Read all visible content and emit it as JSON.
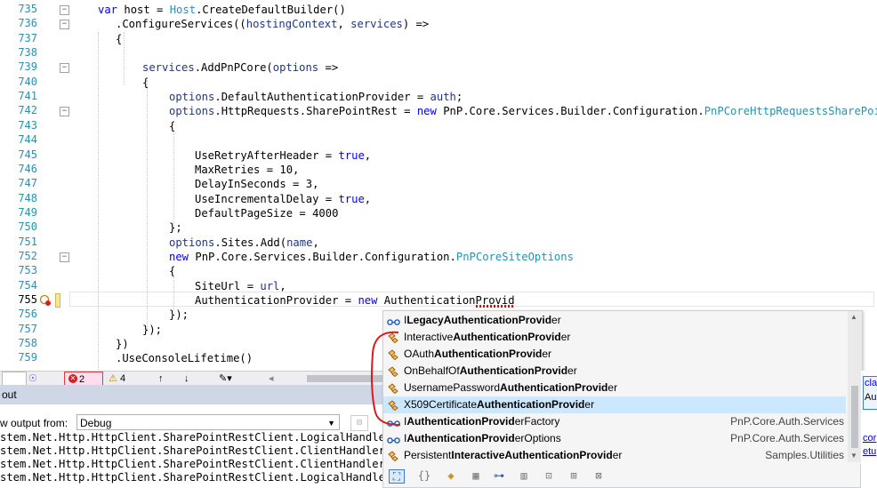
{
  "editor": {
    "lines": [
      {
        "num": "735",
        "text": "var host = Host.CreateDefaultBuilder()"
      },
      {
        "num": "736",
        "text": ".ConfigureServices((hostingContext, services) =>"
      },
      {
        "num": "737",
        "text": "{"
      },
      {
        "num": "738",
        "text": ""
      },
      {
        "num": "739",
        "text": "services.AddPnPCore(options =>"
      },
      {
        "num": "740",
        "text": "{"
      },
      {
        "num": "741",
        "text": "options.DefaultAuthenticationProvider = auth;"
      },
      {
        "num": "742",
        "text": "options.HttpRequests.SharePointRest = new PnP.Core.Services.Builder.Configuration.PnPCoreHttpRequestsSharePoi"
      },
      {
        "num": "743",
        "text": "{"
      },
      {
        "num": "744",
        "text": ""
      },
      {
        "num": "745",
        "text": "UseRetryAfterHeader = true,"
      },
      {
        "num": "746",
        "text": "MaxRetries = 10,"
      },
      {
        "num": "747",
        "text": "DelayInSeconds = 3,"
      },
      {
        "num": "748",
        "text": "UseIncrementalDelay = true,"
      },
      {
        "num": "749",
        "text": "DefaultPageSize = 4000"
      },
      {
        "num": "750",
        "text": "};"
      },
      {
        "num": "751",
        "text": "options.Sites.Add(name,"
      },
      {
        "num": "752",
        "text": "new PnP.Core.Services.Builder.Configuration.PnPCoreSiteOptions"
      },
      {
        "num": "753",
        "text": "{"
      },
      {
        "num": "754",
        "text": "SiteUrl = url,"
      },
      {
        "num": "755",
        "text": "AuthenticationProvider = new AuthenticationProvid"
      },
      {
        "num": "756",
        "text": "});"
      },
      {
        "num": "757",
        "text": "});"
      },
      {
        "num": "758",
        "text": "})"
      },
      {
        "num": "759",
        "text": ".UseConsoleLifetime()"
      }
    ]
  },
  "statusbar": {
    "errors": "2",
    "warnings": "4"
  },
  "output": {
    "title": "out",
    "show_from_label": "w output from:",
    "source": "Debug",
    "lines": [
      "stem.Net.Http.HttpClient.SharePointRestClient.LogicalHandler: I",
      "stem.Net.Http.HttpClient.SharePointRestClient.ClientHandler: I",
      "stem.Net.Http.HttpClient.SharePointRestClient.ClientHandler: I",
      "stem.Net.Http.HttpClient.SharePointRestClient.LogicalHandler: I"
    ]
  },
  "completion": {
    "items": [
      {
        "pre": "I",
        "match": "LegacyAuthenticationProvid",
        "post": "er",
        "ns": "",
        "icon": "interface-icon",
        "selected": false
      },
      {
        "pre": "Interactive",
        "match": "AuthenticationProvid",
        "post": "er",
        "ns": "",
        "icon": "class-icon",
        "selected": false
      },
      {
        "pre": "OAuth",
        "match": "AuthenticationProvid",
        "post": "er",
        "ns": "",
        "icon": "class-icon",
        "selected": false
      },
      {
        "pre": "OnBehalfOf",
        "match": "AuthenticationProvid",
        "post": "er",
        "ns": "",
        "icon": "class-icon",
        "selected": false
      },
      {
        "pre": "UsernamePassword",
        "match": "AuthenticationProvid",
        "post": "er",
        "ns": "",
        "icon": "class-icon",
        "selected": false
      },
      {
        "pre": "X509Certificate",
        "match": "AuthenticationProvid",
        "post": "er",
        "ns": "",
        "icon": "class-icon",
        "selected": true
      },
      {
        "pre": "I",
        "match": "AuthenticationProvid",
        "post": "erFactory",
        "ns": "PnP.Core.Auth.Services",
        "icon": "interface-icon",
        "selected": false
      },
      {
        "pre": "I",
        "match": "AuthenticationProvid",
        "post": "erOptions",
        "ns": "PnP.Core.Auth.Services",
        "icon": "interface-icon",
        "selected": false
      },
      {
        "pre": "Persistent",
        "match": "InteractiveAuthenticationProvid",
        "post": "er",
        "ns": "Samples.Utilities",
        "icon": "class-icon",
        "selected": false
      }
    ]
  },
  "rightpanel": {
    "l1": "cla",
    "l2": "Au",
    "l3": "cor",
    "l4": "etu"
  },
  "colors": {
    "keyword": "#0000ff",
    "type": "#2b91af",
    "selection": "#cce8ff",
    "annotation": "#d81c1c"
  }
}
